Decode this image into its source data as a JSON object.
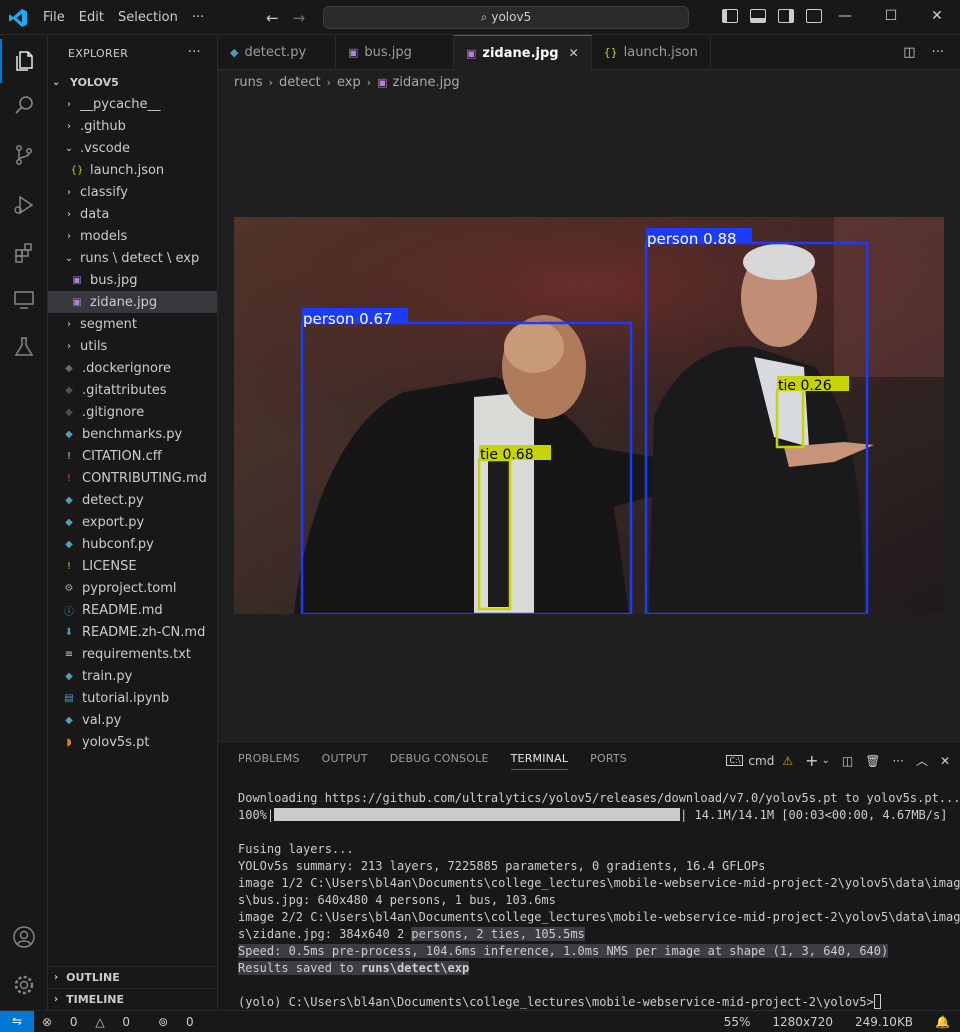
{
  "titlebar": {
    "menu": [
      "File",
      "Edit",
      "Selection",
      "···"
    ],
    "search": "yolov5"
  },
  "sidebar": {
    "title": "EXPLORER",
    "root": "YOLOV5",
    "items": [
      {
        "label": "__pycache__",
        "kind": "folder",
        "depth": 1,
        "expanded": false
      },
      {
        "label": ".github",
        "kind": "folder",
        "depth": 1,
        "expanded": false
      },
      {
        "label": ".vscode",
        "kind": "folder",
        "depth": 1,
        "expanded": true
      },
      {
        "label": "launch.json",
        "kind": "json",
        "depth": 2
      },
      {
        "label": "classify",
        "kind": "folder",
        "depth": 1,
        "expanded": false
      },
      {
        "label": "data",
        "kind": "folder",
        "depth": 1,
        "expanded": false
      },
      {
        "label": "models",
        "kind": "folder",
        "depth": 1,
        "expanded": false
      },
      {
        "label": "runs \\ detect \\ exp",
        "kind": "folder",
        "depth": 1,
        "expanded": true
      },
      {
        "label": "bus.jpg",
        "kind": "image",
        "depth": 2
      },
      {
        "label": "zidane.jpg",
        "kind": "image",
        "depth": 2,
        "selected": true
      },
      {
        "label": "segment",
        "kind": "folder",
        "depth": 1,
        "expanded": false
      },
      {
        "label": "utils",
        "kind": "folder",
        "depth": 1,
        "expanded": false
      },
      {
        "label": ".dockerignore",
        "kind": "docker",
        "depth": 1
      },
      {
        "label": ".gitattributes",
        "kind": "git",
        "depth": 1
      },
      {
        "label": ".gitignore",
        "kind": "git",
        "depth": 1
      },
      {
        "label": "benchmarks.py",
        "kind": "python",
        "depth": 1
      },
      {
        "label": "CITATION.cff",
        "kind": "cff",
        "depth": 1
      },
      {
        "label": "CONTRIBUTING.md",
        "kind": "md-red",
        "depth": 1
      },
      {
        "label": "detect.py",
        "kind": "python",
        "depth": 1
      },
      {
        "label": "export.py",
        "kind": "python",
        "depth": 1
      },
      {
        "label": "hubconf.py",
        "kind": "python",
        "depth": 1
      },
      {
        "label": "LICENSE",
        "kind": "license",
        "depth": 1
      },
      {
        "label": "pyproject.toml",
        "kind": "toml",
        "depth": 1
      },
      {
        "label": "README.md",
        "kind": "info",
        "depth": 1
      },
      {
        "label": "README.zh-CN.md",
        "kind": "md",
        "depth": 1
      },
      {
        "label": "requirements.txt",
        "kind": "txt",
        "depth": 1
      },
      {
        "label": "train.py",
        "kind": "python",
        "depth": 1
      },
      {
        "label": "tutorial.ipynb",
        "kind": "notebook",
        "depth": 1
      },
      {
        "label": "val.py",
        "kind": "python",
        "depth": 1
      },
      {
        "label": "yolov5s.pt",
        "kind": "rss",
        "depth": 1
      }
    ],
    "outline": "OUTLINE",
    "timeline": "TIMELINE"
  },
  "tabs": [
    {
      "label": "detect.py",
      "kind": "python",
      "active": false
    },
    {
      "label": "bus.jpg",
      "kind": "image",
      "active": false
    },
    {
      "label": "zidane.jpg",
      "kind": "image",
      "active": true
    },
    {
      "label": "launch.json",
      "kind": "json",
      "active": false
    }
  ],
  "breadcrumb": [
    "runs",
    "detect",
    "exp",
    "zidane.jpg"
  ],
  "detections": [
    {
      "label": "person 0.67",
      "color": "#1d3bff"
    },
    {
      "label": "person 0.88",
      "color": "#1d3bff"
    },
    {
      "label": "tie 0.68",
      "color": "#c8d400"
    },
    {
      "label": "tie 0.26",
      "color": "#c8d400"
    }
  ],
  "panel": {
    "tabs": [
      "PROBLEMS",
      "OUTPUT",
      "DEBUG CONSOLE",
      "TERMINAL",
      "PORTS"
    ],
    "active_tab": "TERMINAL",
    "shell": "cmd",
    "lines": {
      "download": "Downloading https://github.com/ultralytics/yolov5/releases/download/v7.0/yolov5s.pt to yolov5s.pt...",
      "progress_pct": "100%|",
      "progress_tail": "| 14.1M/14.1M [00:03<00:00, 4.67MB/s]",
      "fusing": "Fusing layers...",
      "summary": "YOLOv5s summary: 213 layers, 7225885 parameters, 0 gradients, 16.4 GFLOPs",
      "img1a": "image 1/2 C:\\Users\\bl4an\\Documents\\college_lectures\\mobile-webservice-mid-project-2\\yolov5\\data\\image",
      "img1b": "s\\bus.jpg: 640x480 4 persons, 1 bus, 103.6ms",
      "img2a": "image 2/2 C:\\Users\\bl4an\\Documents\\college_lectures\\mobile-webservice-mid-project-2\\yolov5\\data\\image",
      "img2b_pre": "s\\zidane.jpg: 384x640 2 ",
      "img2b_hl": "persons, 2 ties, 105.5ms",
      "speed": "Speed: 0.5ms pre-process, 104.6ms inference, 1.0ms NMS per image at shape (1, 3, 640, 640)",
      "saved_pre": "Results saved to ",
      "saved_bold": "runs\\detect\\exp",
      "prompt": "(yolo) C:\\Users\\bl4an\\Documents\\college_lectures\\mobile-webservice-mid-project-2\\yolov5>"
    }
  },
  "statusbar": {
    "errors": "0",
    "warnings": "0",
    "ports": "0",
    "zoom": "55%",
    "resolution": "1280x720",
    "size": "249.10KB"
  }
}
